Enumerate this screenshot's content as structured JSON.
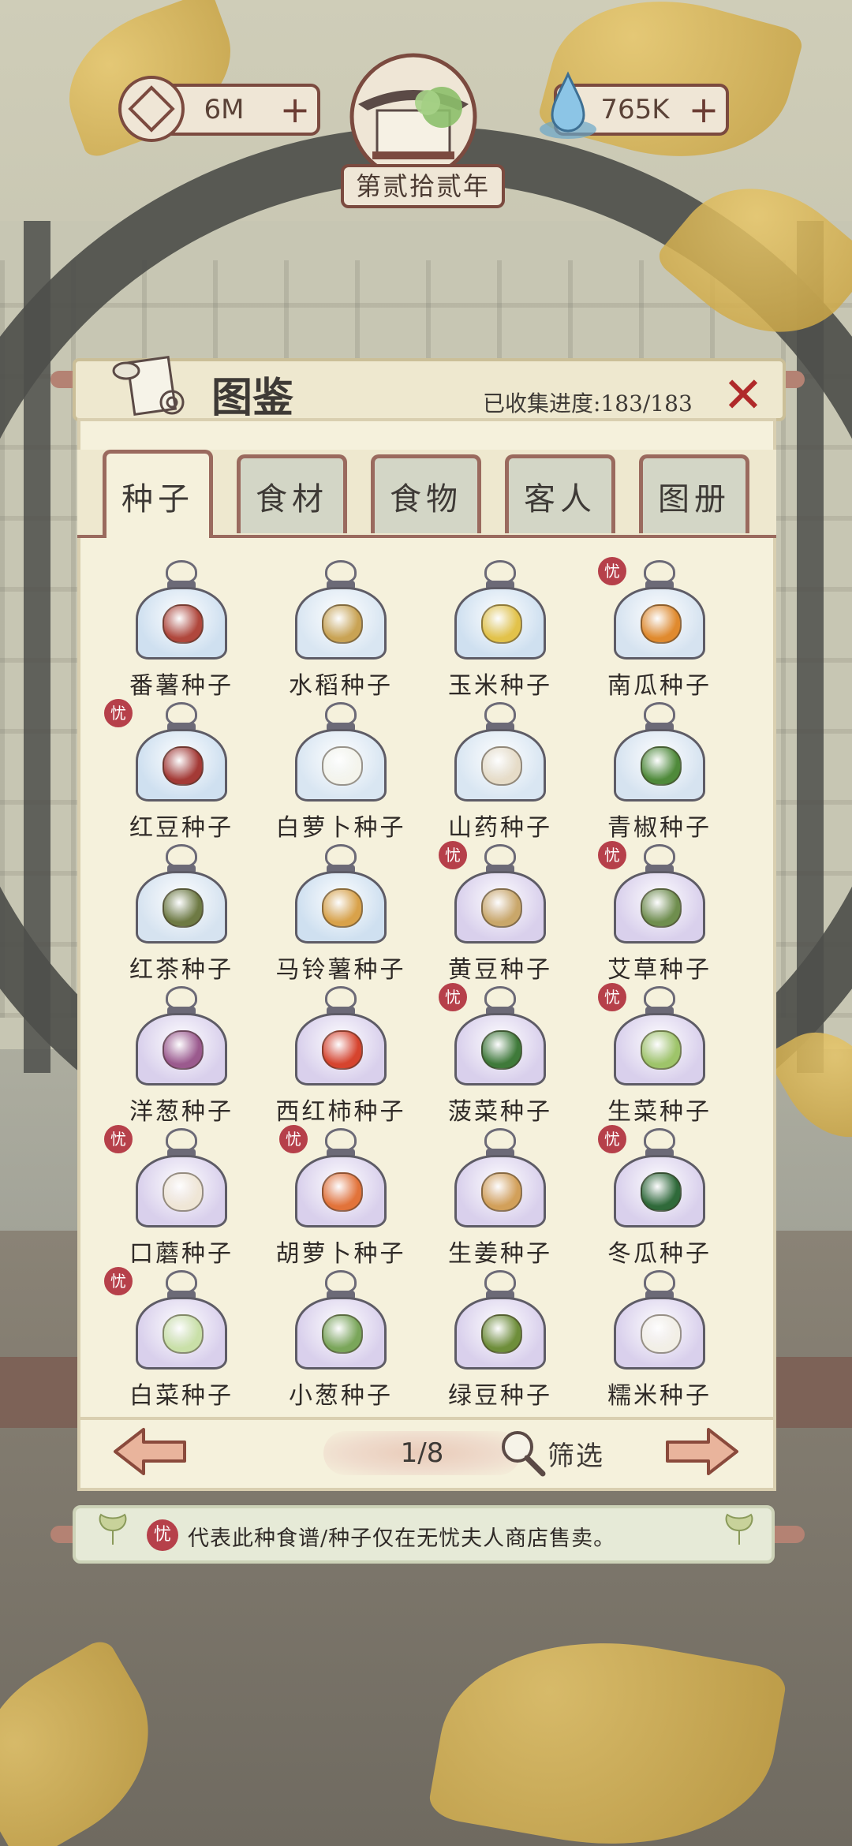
{
  "hud": {
    "coins": "6M",
    "coins_plus": "+",
    "gems": "765K",
    "gems_plus": "+",
    "year": "第贰拾贰年"
  },
  "panel": {
    "title": "图鉴",
    "progress": "已收集进度:183/183",
    "close": "✕"
  },
  "tabs": [
    {
      "label": "种子",
      "active": true
    },
    {
      "label": "食材",
      "active": false
    },
    {
      "label": "食物",
      "active": false
    },
    {
      "label": "客人",
      "active": false
    },
    {
      "label": "图册",
      "active": false
    }
  ],
  "badge_char": "忧",
  "seeds": [
    {
      "label": "番薯种子",
      "badge": false,
      "bag": "#cfe0f0",
      "veg": "#b0473c"
    },
    {
      "label": "水稻种子",
      "badge": false,
      "bag": "#d9e6f2",
      "veg": "#c9a354"
    },
    {
      "label": "玉米种子",
      "badge": false,
      "bag": "#cfe0f0",
      "veg": "#e2c24a"
    },
    {
      "label": "南瓜种子",
      "badge": true,
      "bag": "#d6e3f0",
      "veg": "#e08a2e"
    },
    {
      "label": "红豆种子",
      "badge": true,
      "bag": "#cfe0f0",
      "veg": "#a43a36"
    },
    {
      "label": "白萝卜种子",
      "badge": false,
      "bag": "#d9e6f2",
      "veg": "#f4f4ec"
    },
    {
      "label": "山药种子",
      "badge": false,
      "bag": "#d9e6f2",
      "veg": "#e6dcc8"
    },
    {
      "label": "青椒种子",
      "badge": false,
      "bag": "#d6e3f0",
      "veg": "#4f8a3a"
    },
    {
      "label": "红茶种子",
      "badge": false,
      "bag": "#d6e3f0",
      "veg": "#6e7a44"
    },
    {
      "label": "马铃薯种子",
      "badge": false,
      "bag": "#cfe0f0",
      "veg": "#d9a24a"
    },
    {
      "label": "黄豆种子",
      "badge": true,
      "bag": "#d9d0ec",
      "veg": "#c9a76a"
    },
    {
      "label": "艾草种子",
      "badge": true,
      "bag": "#d9d0ec",
      "veg": "#6f8e4e"
    },
    {
      "label": "洋葱种子",
      "badge": false,
      "bag": "#d9d0ec",
      "veg": "#9b5a8e"
    },
    {
      "label": "西红柿种子",
      "badge": false,
      "bag": "#d9d0ec",
      "veg": "#d6442e"
    },
    {
      "label": "菠菜种子",
      "badge": true,
      "bag": "#d9d0ec",
      "veg": "#3f7a3a"
    },
    {
      "label": "生菜种子",
      "badge": true,
      "bag": "#d9d0ec",
      "veg": "#9ec46a"
    },
    {
      "label": "口蘑种子",
      "badge": true,
      "bag": "#d9d0ec",
      "veg": "#efe6d6"
    },
    {
      "label": "胡萝卜种子",
      "badge": true,
      "bag": "#d9d0ec",
      "veg": "#e2733a"
    },
    {
      "label": "生姜种子",
      "badge": false,
      "bag": "#d9d0ec",
      "veg": "#d2a05a"
    },
    {
      "label": "冬瓜种子",
      "badge": true,
      "bag": "#d9d0ec",
      "veg": "#2f6a3a"
    },
    {
      "label": "白菜种子",
      "badge": true,
      "bag": "#d9d0ec",
      "veg": "#c9e0a8"
    },
    {
      "label": "小葱种子",
      "badge": false,
      "bag": "#d9d0ec",
      "veg": "#7aa65a"
    },
    {
      "label": "绿豆种子",
      "badge": false,
      "bag": "#d9d0ec",
      "veg": "#6e8e3a"
    },
    {
      "label": "糯米种子",
      "badge": false,
      "bag": "#d9d0ec",
      "veg": "#f2efe6"
    }
  ],
  "pager": {
    "page": "1/8",
    "filter_label": "筛选"
  },
  "note": {
    "text": "代表此种食谱/种子仅在无忧夫人商店售卖。"
  },
  "colors": {
    "accent_red": "#b6404a",
    "frame_brown": "#9a6a5e",
    "panel_bg": "#f5f1dc"
  }
}
